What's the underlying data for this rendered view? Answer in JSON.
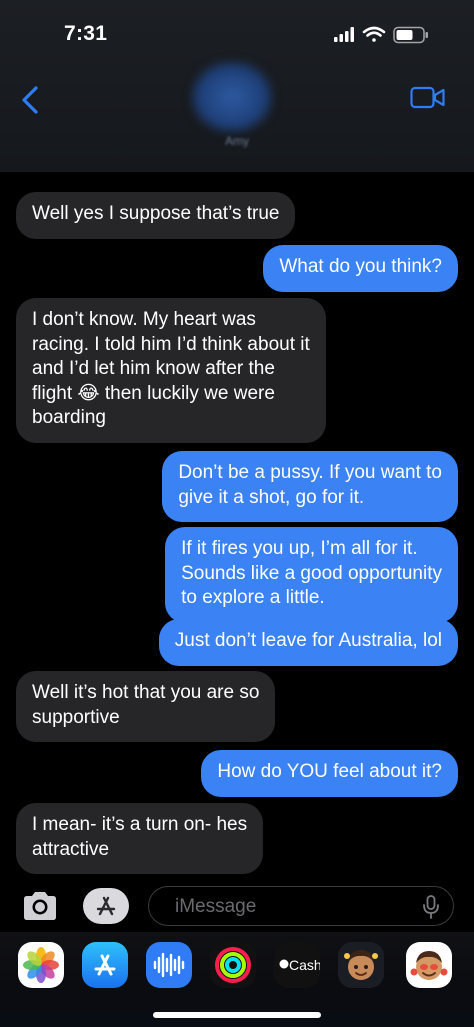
{
  "status_bar": {
    "time": "7:31"
  },
  "header": {
    "contact_name": "Amy"
  },
  "messages": [
    {
      "dir": "in",
      "text": "Well yes I suppose that’s true"
    },
    {
      "dir": "out",
      "text": "What do you think?"
    },
    {
      "dir": "in",
      "text": "I don’t know. My heart was\nracing. I told him I’d think about it\nand I’d let him know after the\nflight 😂 then luckily we were\nboarding"
    },
    {
      "dir": "out",
      "text": "Don’t be a pussy. If you want to\ngive it a shot, go for it."
    },
    {
      "dir": "out",
      "text": "If it fires you up, I’m all for it.\nSounds like a good opportunity\nto explore a little."
    },
    {
      "dir": "out",
      "text": "Just don’t leave for Australia, lol"
    },
    {
      "dir": "in",
      "text": "Well it’s hot that you are so\nsupportive"
    },
    {
      "dir": "out",
      "text": "How do YOU feel about it?"
    },
    {
      "dir": "in",
      "text": "I mean- it’s a turn on- hes\nattractive"
    }
  ],
  "composer": {
    "placeholder": "iMessage"
  },
  "app_drawer": [
    {
      "icon": "photos-icon"
    },
    {
      "icon": "app-store-icon"
    },
    {
      "icon": "audio-message-icon"
    },
    {
      "icon": "activity-icon"
    },
    {
      "icon": "apple-cash-icon",
      "label": "Cash"
    },
    {
      "icon": "memoji-icon"
    },
    {
      "icon": "memoji-stickers-icon"
    }
  ],
  "colors": {
    "incoming": "#262628",
    "outgoing": "#3b82f5",
    "accent": "#2f7cf6"
  }
}
